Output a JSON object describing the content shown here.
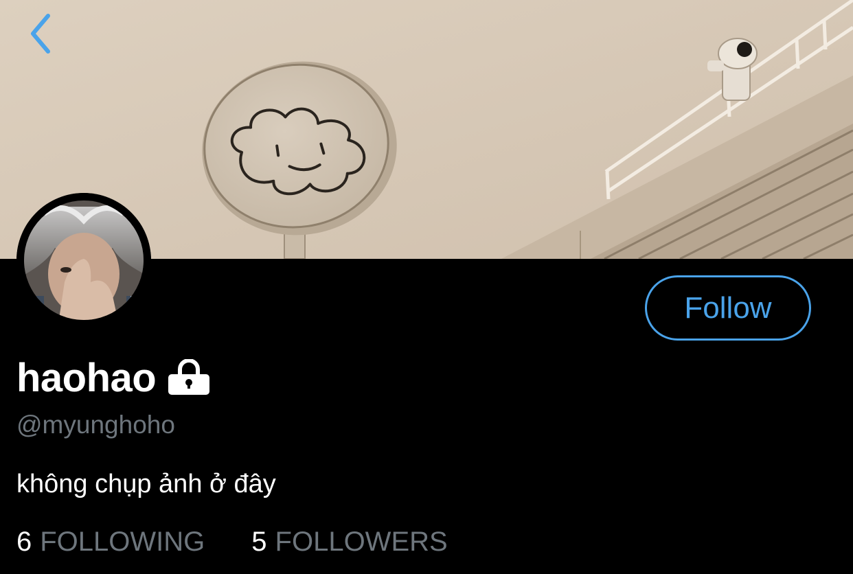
{
  "colors": {
    "background": "#000000",
    "accent": "#4aa3ea",
    "secondary_text": "#6e767d",
    "primary_text": "#ffffff",
    "banner_tone": "#d6c8b7"
  },
  "header": {
    "back_icon": "chevron-left-icon",
    "banner_image": "sepia photo of round sign with cloud face drawing and rooftop railing"
  },
  "profile": {
    "avatar": "avatar-photo",
    "display_name": "haohao",
    "protected_icon": "lock-icon",
    "handle": "@myunghoho",
    "bio": "không chụp ảnh ở đây",
    "follow_label": "Follow"
  },
  "stats": {
    "following_count": "6",
    "following_label": "FOLLOWING",
    "followers_count": "5",
    "followers_label": "FOLLOWERS"
  }
}
